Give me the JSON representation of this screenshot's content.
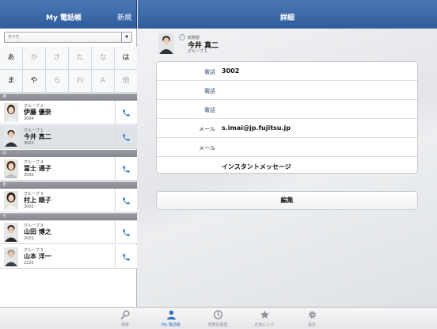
{
  "left_header": {
    "title": "My 電話帳",
    "new_label": "新規"
  },
  "right_header": {
    "title": "詳細"
  },
  "group_select": {
    "value": "すべて"
  },
  "kana_keys": [
    {
      "label": "あ",
      "enabled": true
    },
    {
      "label": "か",
      "enabled": false
    },
    {
      "label": "さ",
      "enabled": false
    },
    {
      "label": "た",
      "enabled": false
    },
    {
      "label": "な",
      "enabled": false
    },
    {
      "label": "は",
      "enabled": true
    },
    {
      "label": "ま",
      "enabled": true
    },
    {
      "label": "や",
      "enabled": true
    },
    {
      "label": "ら",
      "enabled": false
    },
    {
      "label": "わ",
      "enabled": false
    },
    {
      "label": "A",
      "enabled": false
    },
    {
      "label": "他",
      "enabled": false
    }
  ],
  "sections": [
    "あ",
    "は",
    "ま",
    "や"
  ],
  "contacts": [
    {
      "group": "グループ 2",
      "name": "伊藤 優奈",
      "ext": "3004"
    },
    {
      "group": "グループ 1",
      "name": "今井 真二",
      "ext": "3002"
    },
    {
      "group": "グループ 4",
      "name": "冨士 通子",
      "ext": "3000"
    },
    {
      "group": "グループ 3",
      "name": "村上 順子",
      "ext": "3003"
    },
    {
      "group": "グループ 3",
      "name": "山田 博之",
      "ext": "2001"
    },
    {
      "group": "グループ 3",
      "name": "山本 洋一",
      "ext": "2225"
    }
  ],
  "detail": {
    "dept": "総務部",
    "name": "今井 真二",
    "group": "グループ 1",
    "fields": [
      {
        "label": "電話",
        "value": "3002"
      },
      {
        "label": "電話",
        "value": ""
      },
      {
        "label": "電話",
        "value": ""
      },
      {
        "label": "メール",
        "value": "s.imai@jp.fujitsu.jp"
      },
      {
        "label": "メール",
        "value": ""
      }
    ],
    "im_label": "インスタントメッセージ",
    "edit_label": "編集"
  },
  "tabs": [
    {
      "label": "検索",
      "icon": "search-icon"
    },
    {
      "label": "My 電話帳",
      "icon": "person-icon"
    },
    {
      "label": "発着信履歴",
      "icon": "clock-icon"
    },
    {
      "label": "お気に入り",
      "icon": "star-icon"
    },
    {
      "label": "設定",
      "icon": "gear-icon"
    }
  ],
  "colors": {
    "header": "#3a68a8",
    "accent": "#2f6fc2",
    "call_icon": "#2c7ad6"
  }
}
